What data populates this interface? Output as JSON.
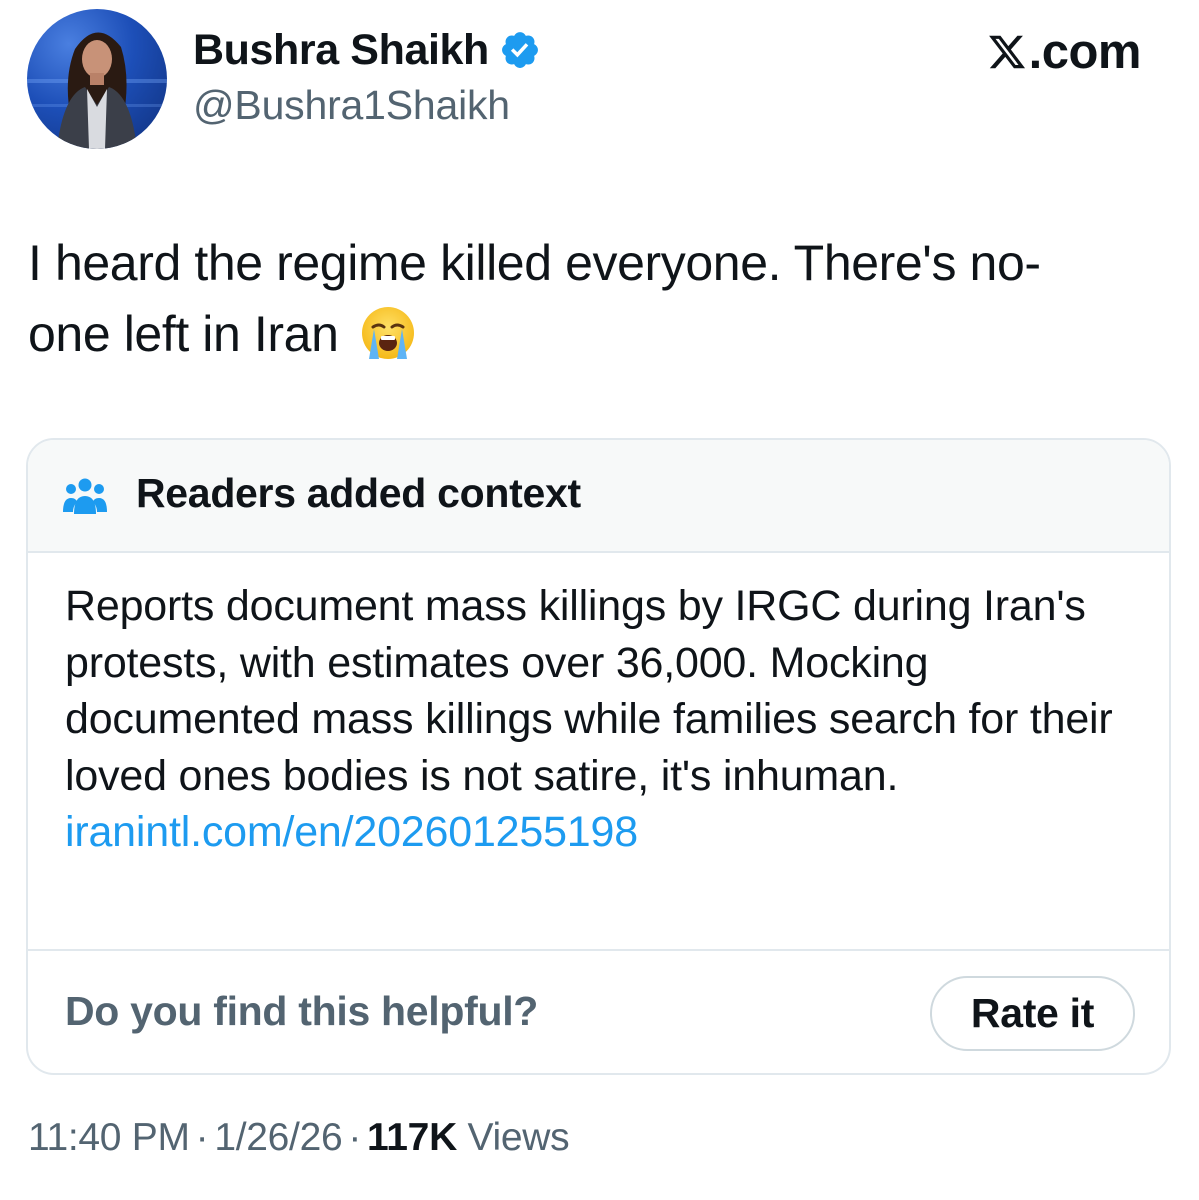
{
  "author": {
    "display_name": "Bushra Shaikh",
    "handle": "@Bushra1Shaikh",
    "verified": true
  },
  "source": {
    "logo_text": ".com",
    "logo_icon": "x-logo-icon"
  },
  "tweet": {
    "text_line1": "I heard the regime killed everyone. There's no-",
    "text_line2": "one left in Iran",
    "emoji": "loudly-crying-face-emoji"
  },
  "community_note": {
    "header_icon": "people-icon",
    "title": "Readers added context",
    "body": "Reports document mass killings by IRGC during Iran's protests, with estimates over 36,000. Mocking documented mass killings while families search for their loved ones bodies is not satire, it's inhuman.",
    "link_text": "iranintl.com/en/202601255198",
    "helpful_question": "Do you find this helpful?",
    "rate_button_label": "Rate it"
  },
  "meta": {
    "time": "11:40 PM",
    "date": "1/26/26",
    "separator": "·",
    "views_count": "117K",
    "views_label": "Views"
  },
  "colors": {
    "link": "#1d9bf0",
    "verified": "#1d9bf0",
    "secondary_text": "#536471",
    "primary_text": "#0f1419",
    "note_header_bg": "#f7f9f9",
    "border": "#e1e8ed"
  }
}
